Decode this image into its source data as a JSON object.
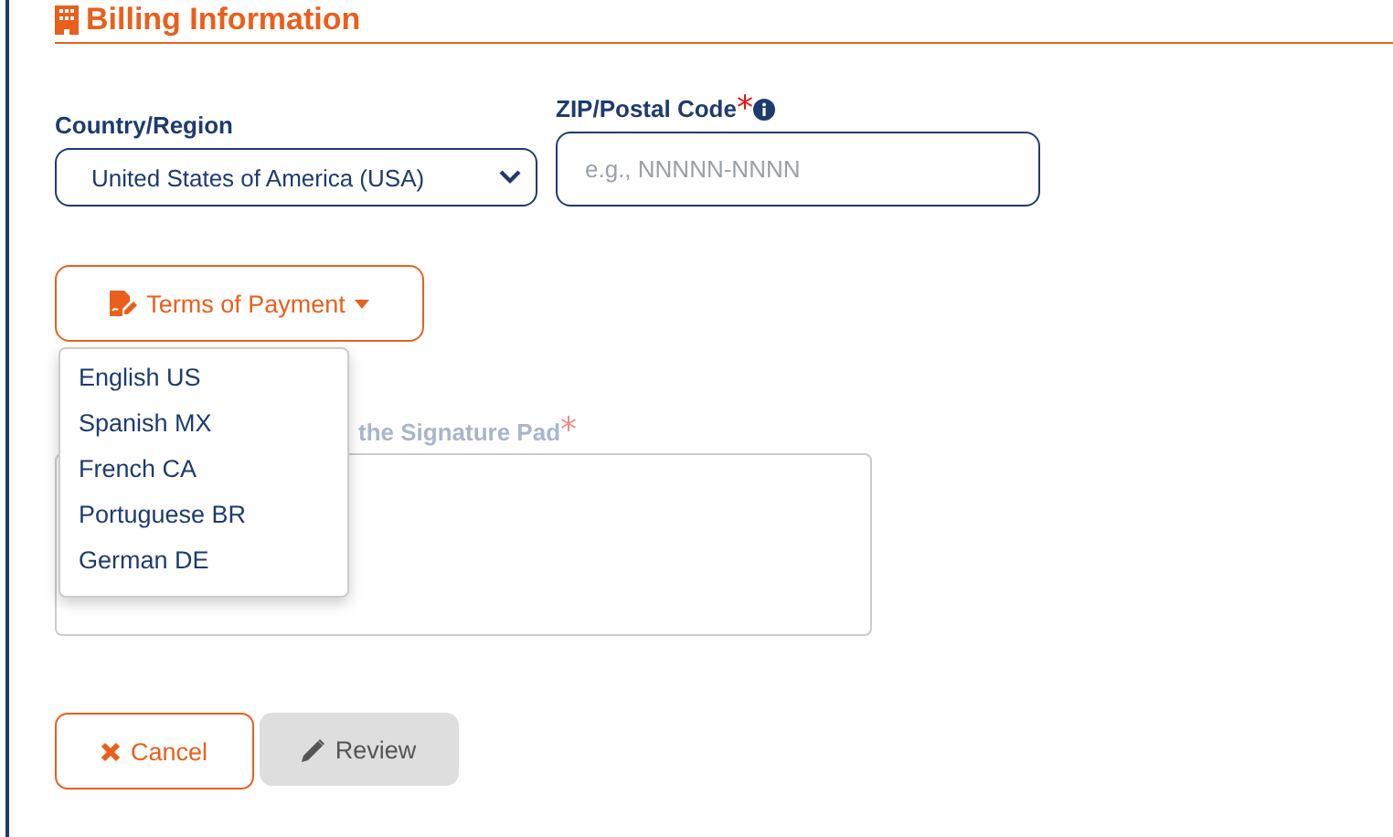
{
  "section": {
    "title": "Billing Information"
  },
  "fields": [
    {
      "kind": "select",
      "label": "Country/Region",
      "value": "United States of America (USA)"
    },
    {
      "kind": "text",
      "label": "ZIP/Postal Code",
      "required_mark": "*",
      "info": true,
      "placeholder": "e.g., NNNNN-NNNN"
    }
  ],
  "terms_button": {
    "label": "Terms of Payment",
    "expanded": true
  },
  "terms_menu": [
    {
      "label": "English US"
    },
    {
      "label": "Spanish MX"
    },
    {
      "label": "French CA"
    },
    {
      "label": "Portuguese BR"
    },
    {
      "label": "German DE"
    }
  ],
  "signature": {
    "label": "the Signature Pad",
    "required_mark": "*"
  },
  "buttons": [
    {
      "kind": "cancel",
      "label": "Cancel",
      "disabled": false
    },
    {
      "kind": "review",
      "label": "Review",
      "disabled": true
    }
  ]
}
